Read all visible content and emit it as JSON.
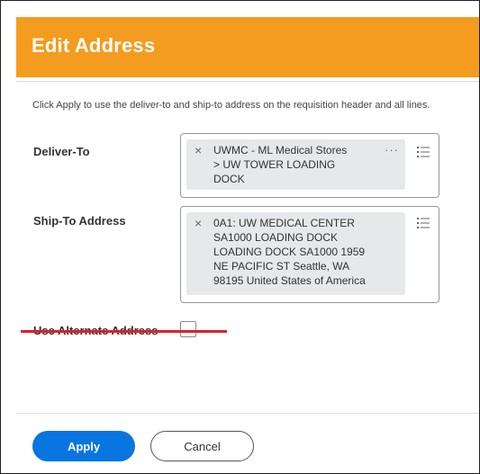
{
  "dialog": {
    "title": "Edit Address",
    "instructions": "Click Apply to use the deliver-to and ship-to address on the requisition header and all lines."
  },
  "deliver_to": {
    "label": "Deliver-To",
    "selection": "UWMC - ML Medical Stores\n> UW TOWER LOADING\nDOCK",
    "more_icon": "ellipsis-icon",
    "list_icon": "list-icon",
    "remove_icon": "close-icon"
  },
  "ship_to": {
    "label": "Ship-To Address",
    "selection": "0A1: UW MEDICAL CENTER\nSA1000 LOADING DOCK\nLOADING DOCK SA1000 1959\nNE PACIFIC ST Seattle, WA\n98195 United States of America",
    "list_icon": "list-icon",
    "remove_icon": "close-icon"
  },
  "alternate": {
    "label": "Use Alternate Address",
    "checked": false,
    "annotation_color": "#e01e2c"
  },
  "footer": {
    "apply_label": "Apply",
    "cancel_label": "Cancel"
  },
  "colors": {
    "header": "#f39c1f",
    "primary_button": "#0875e1"
  }
}
